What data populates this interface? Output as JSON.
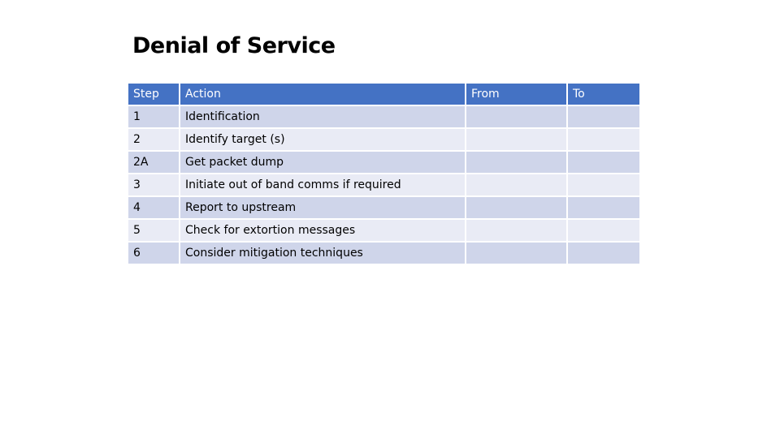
{
  "title": "Denial of Service",
  "table": {
    "headers": [
      "Step",
      "Action",
      "From",
      "To"
    ],
    "rows": [
      {
        "step": "1",
        "action": "Identification",
        "from": "",
        "to": ""
      },
      {
        "step": "2",
        "action": "Identify target (s)",
        "from": "",
        "to": ""
      },
      {
        "step": "2A",
        "action": "Get packet dump",
        "from": "",
        "to": ""
      },
      {
        "step": "3",
        "action": "Initiate out of band comms if required",
        "from": "",
        "to": ""
      },
      {
        "step": "4",
        "action": "Report to upstream",
        "from": "",
        "to": ""
      },
      {
        "step": "5",
        "action": "Check for extortion messages",
        "from": "",
        "to": ""
      },
      {
        "step": "6",
        "action": "Consider mitigation techniques",
        "from": "",
        "to": ""
      }
    ]
  },
  "colors": {
    "header": "#4472c4",
    "row_odd": "#cfd5ea",
    "row_even": "#e9ebf5"
  }
}
